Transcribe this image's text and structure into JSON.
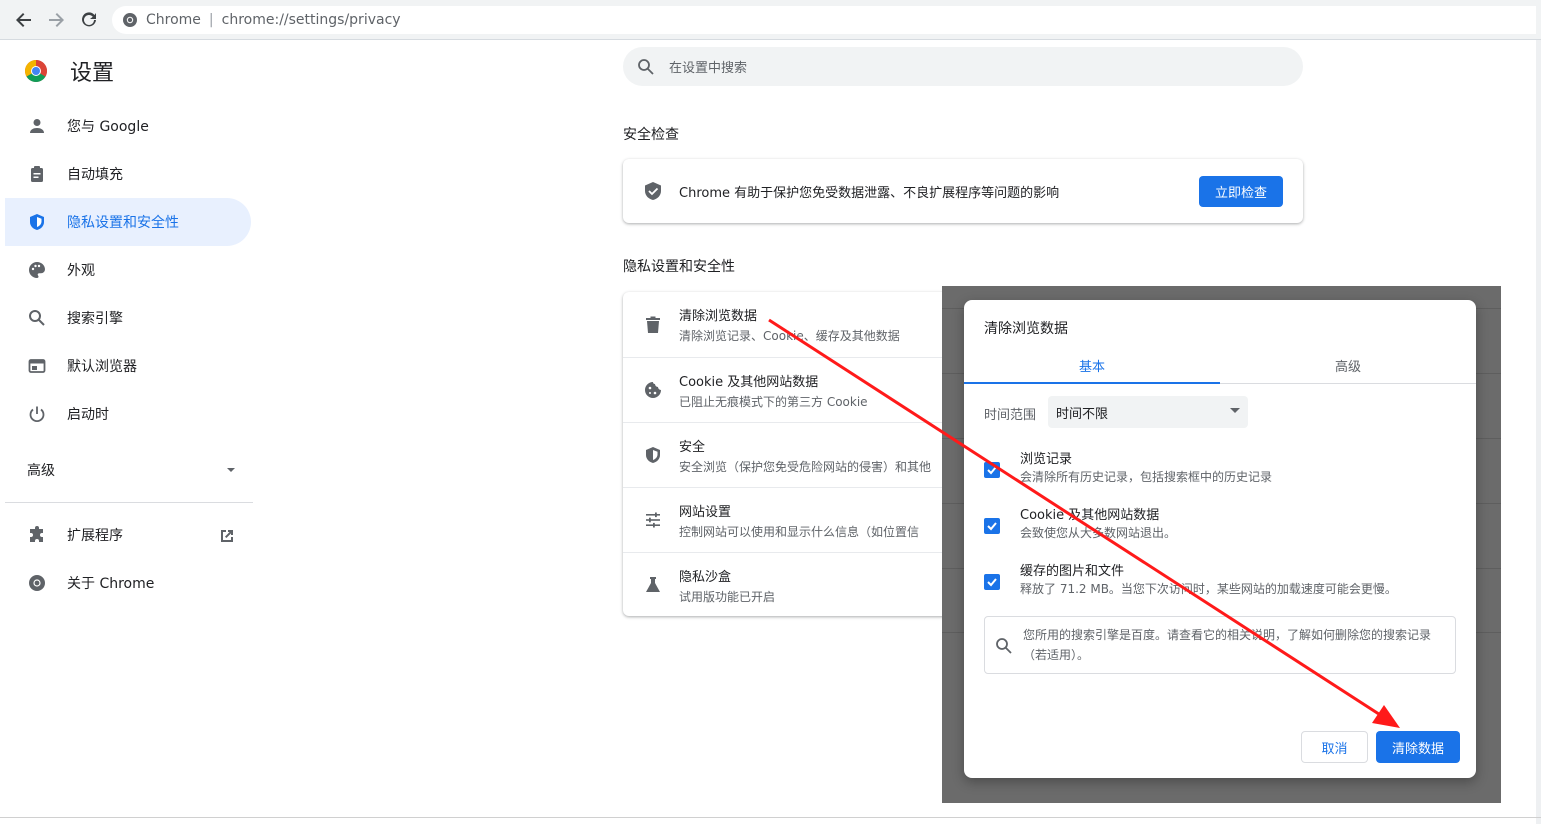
{
  "browser": {
    "omnibox_site": "Chrome",
    "omnibox_url": "chrome://settings/privacy"
  },
  "sidebar": {
    "title": "设置",
    "items": [
      {
        "label": "您与 Google",
        "icon": "person-icon"
      },
      {
        "label": "自动填充",
        "icon": "clipboard-icon"
      },
      {
        "label": "隐私设置和安全性",
        "icon": "shield-icon"
      },
      {
        "label": "外观",
        "icon": "palette-icon"
      },
      {
        "label": "搜索引擎",
        "icon": "search-icon"
      },
      {
        "label": "默认浏览器",
        "icon": "browser-window-icon"
      },
      {
        "label": "启动时",
        "icon": "power-icon"
      }
    ],
    "advanced_label": "高级",
    "extensions_label": "扩展程序",
    "about_label": "关于 Chrome"
  },
  "search": {
    "placeholder": "在设置中搜索"
  },
  "safety": {
    "section_title": "安全检查",
    "text": "Chrome 有助于保护您免受数据泄露、不良扩展程序等问题的影响",
    "button_label": "立即检查"
  },
  "privacy": {
    "section_title": "隐私设置和安全性",
    "rows": [
      {
        "title": "清除浏览数据",
        "subtitle": "清除浏览记录、Cookie、缓存及其他数据"
      },
      {
        "title": "Cookie 及其他网站数据",
        "subtitle": "已阻止无痕模式下的第三方 Cookie"
      },
      {
        "title": "安全",
        "subtitle": "安全浏览（保护您免受危险网站的侵害）和其他"
      },
      {
        "title": "网站设置",
        "subtitle": "控制网站可以使用和显示什么信息（如位置信"
      },
      {
        "title": "隐私沙盒",
        "subtitle": "试用版功能已开启"
      }
    ]
  },
  "dialog": {
    "title": "清除浏览数据",
    "tabs": [
      "基本",
      "高级"
    ],
    "time_range_label": "时间范围",
    "time_range_value": "时间不限",
    "checkboxes": [
      {
        "title": "浏览记录",
        "subtitle": "会清除所有历史记录，包括搜索框中的历史记录",
        "checked": true
      },
      {
        "title": "Cookie 及其他网站数据",
        "subtitle": "会致使您从大多数网站退出。",
        "checked": true
      },
      {
        "title": "缓存的图片和文件",
        "subtitle": "释放了 71.2 MB。当您下次访问时，某些网站的加载速度可能会更慢。",
        "checked": true
      }
    ],
    "info_text": "您所用的搜索引擎是百度。请查看它的相关说明，了解如何删除您的搜索记录（若适用）。",
    "cancel_label": "取消",
    "clear_label": "清除数据"
  },
  "colors": {
    "accent": "#1a73e8",
    "active_bg": "#e8f0fe",
    "overlay": "#6b6b6b",
    "annotation_arrow": "#ff1a1a"
  }
}
